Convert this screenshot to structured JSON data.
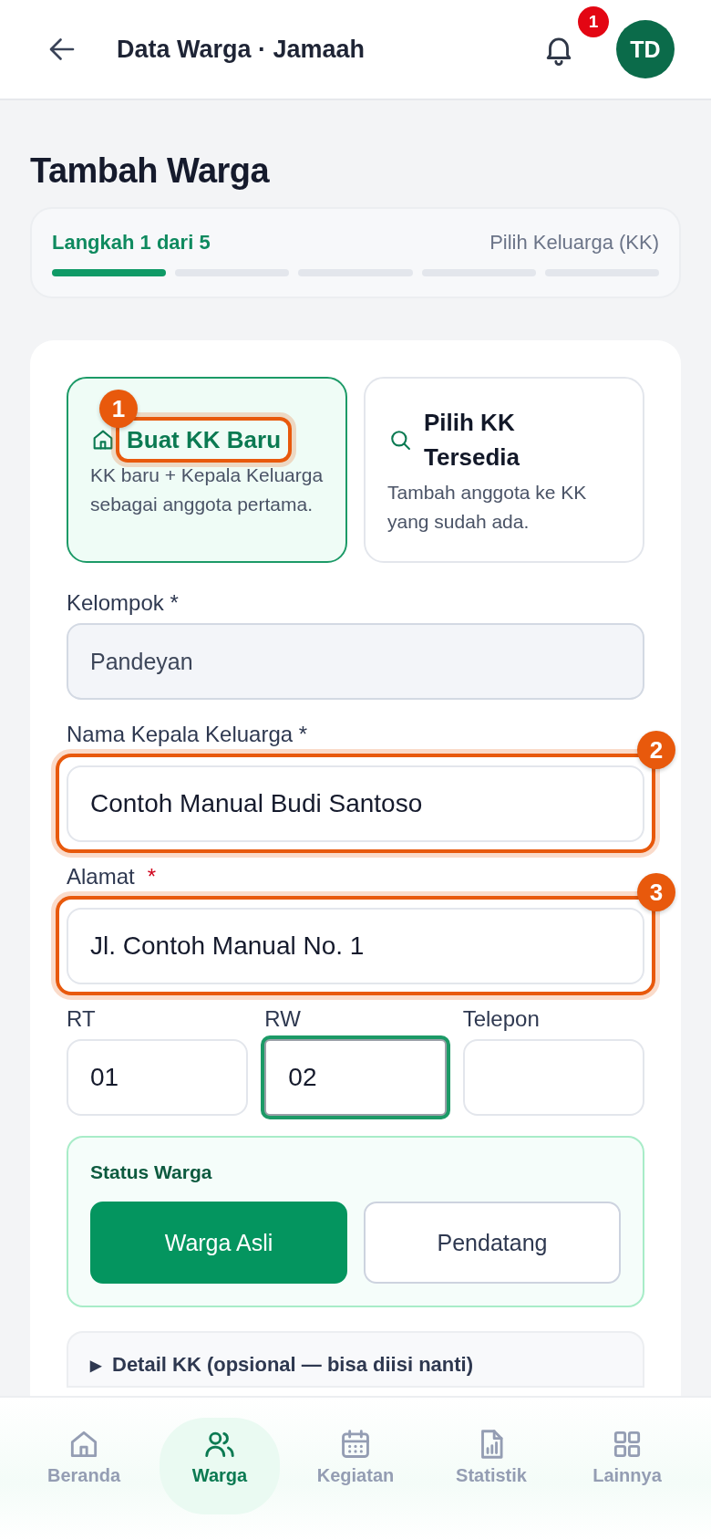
{
  "header": {
    "title": "Data Warga · Jamaah",
    "notification_count": "1",
    "avatar": "TD"
  },
  "page_title": "Tambah Warga",
  "stepper": {
    "label": "Langkah 1 dari 5",
    "step_name": "Pilih Keluarga (KK)",
    "steps": [
      {
        "done": true
      },
      {
        "done": false
      },
      {
        "done": false
      },
      {
        "done": false
      },
      {
        "done": false
      }
    ]
  },
  "mode_options": [
    {
      "title": "Buat KK Baru",
      "description": "KK baru + Kepala Keluarga sebagai anggota pertama.",
      "selected": true,
      "annotation": "1"
    },
    {
      "title": "Pilih KK Tersedia",
      "description": "Tambah anggota ke KK yang sudah ada.",
      "selected": false
    }
  ],
  "fields": [
    {
      "label": "Kelompok *",
      "value": "Pandeyan",
      "disabled": true
    },
    {
      "label": "Nama Kepala Keluarga *",
      "value": "Contoh Manual Budi Santoso",
      "annotation": "2"
    },
    {
      "label": "Alamat",
      "required_mark": "*",
      "value": "Jl. Contoh Manual No. 1",
      "annotation": "3"
    }
  ],
  "short_fields": [
    {
      "label": "RT",
      "value": "01",
      "focused": false
    },
    {
      "label": "RW",
      "value": "02",
      "focused": true
    },
    {
      "label": "Telepon",
      "focused": false
    }
  ],
  "status": {
    "title": "Status Warga",
    "options": [
      {
        "label": "Warga Asli",
        "selected": true
      },
      {
        "label": "Pendatang",
        "selected": false
      }
    ]
  },
  "details": {
    "toggle": "▶",
    "label": "Detail KK (opsional — bisa diisi nanti)",
    "expanded": false
  },
  "nav": [
    {
      "label": "Beranda",
      "selected": false
    },
    {
      "label": "Warga",
      "selected": true
    },
    {
      "label": "Kegiatan",
      "selected": false
    },
    {
      "label": "Statistik",
      "selected": false
    },
    {
      "label": "Lainnya",
      "selected": false
    }
  ]
}
